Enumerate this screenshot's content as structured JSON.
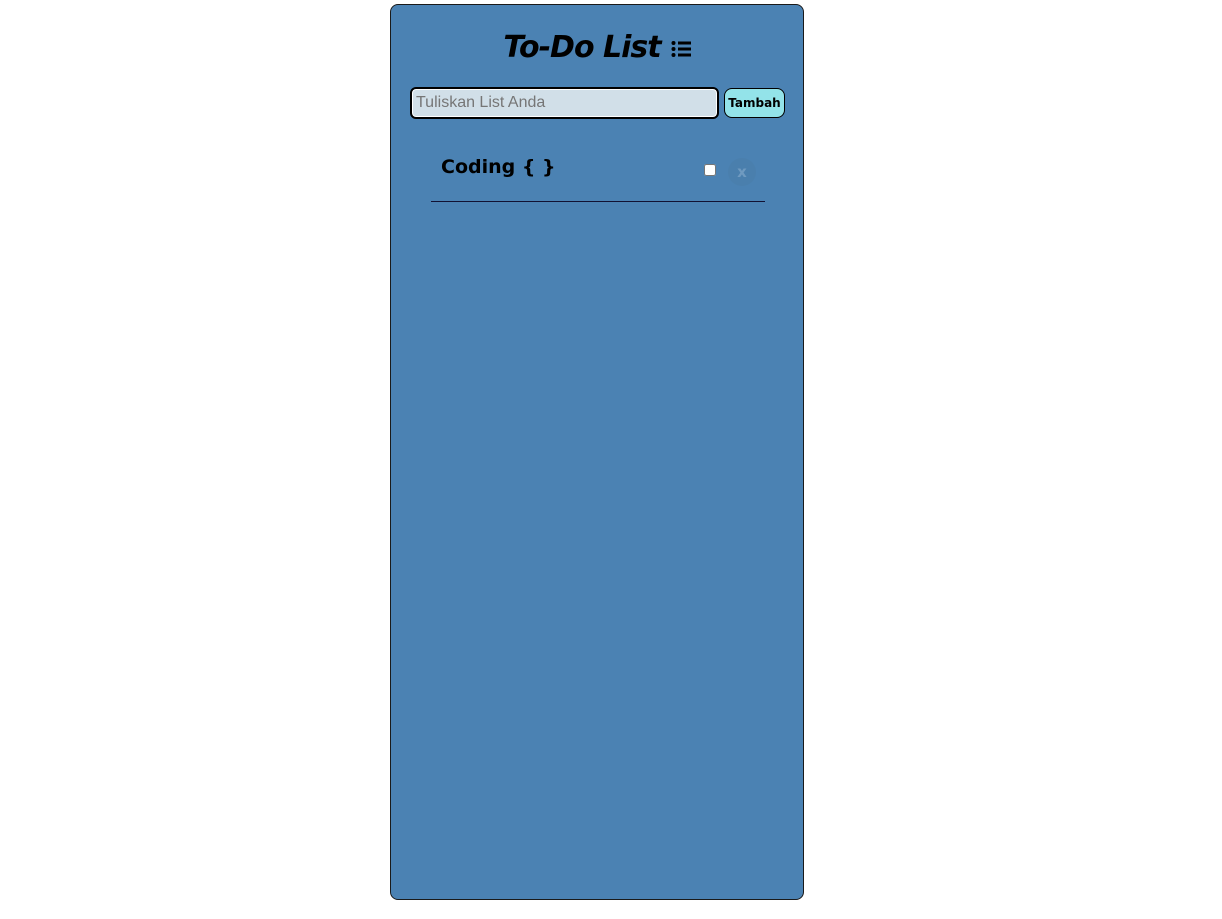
{
  "app": {
    "title": "To-Do List",
    "title_icon": "list-icon"
  },
  "form": {
    "input_value": "",
    "input_placeholder": "Tuliskan List Anda",
    "add_label": "Tambah"
  },
  "todos": [
    {
      "text": "Coding { }",
      "checked": false,
      "delete_label": "x"
    }
  ],
  "colors": {
    "panel_background": "#4b82b3",
    "input_background": "#d1dfe8",
    "add_button_background": "#93e3e9",
    "divider": "#111133"
  }
}
